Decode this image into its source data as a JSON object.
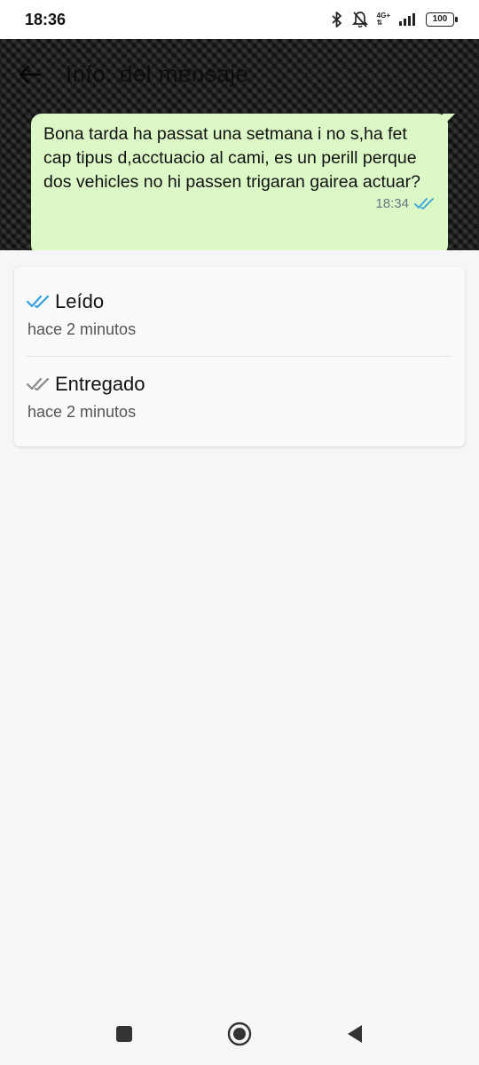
{
  "status_bar": {
    "time": "18:36",
    "network": "4G+",
    "battery": "100",
    "icons": [
      "bluetooth-icon",
      "notifications-off-icon",
      "signal-icon",
      "battery-icon"
    ]
  },
  "header": {
    "title": "Info. del mensaje",
    "back_icon": "arrow-back-icon"
  },
  "message": {
    "text": "Bona tarda ha passat una setmana i no s,ha fet cap tipus d,acctuacio al cami, es un perill perque dos vehicles no hi passen trigaran gairea actuar?",
    "time": "18:34",
    "status_icon": "double-check-read-icon",
    "bubble_color": "#dcf8c6"
  },
  "receipts": [
    {
      "label": "Leído",
      "time": "hace 2 minutos",
      "icon": "double-check-blue-icon",
      "color": "#34a1de"
    },
    {
      "label": "Entregado",
      "time": "hace 2 minutos",
      "icon": "double-check-grey-icon",
      "color": "#8a8a8a"
    }
  ],
  "nav": [
    "recents-square-icon",
    "home-circle-icon",
    "back-triangle-icon"
  ]
}
